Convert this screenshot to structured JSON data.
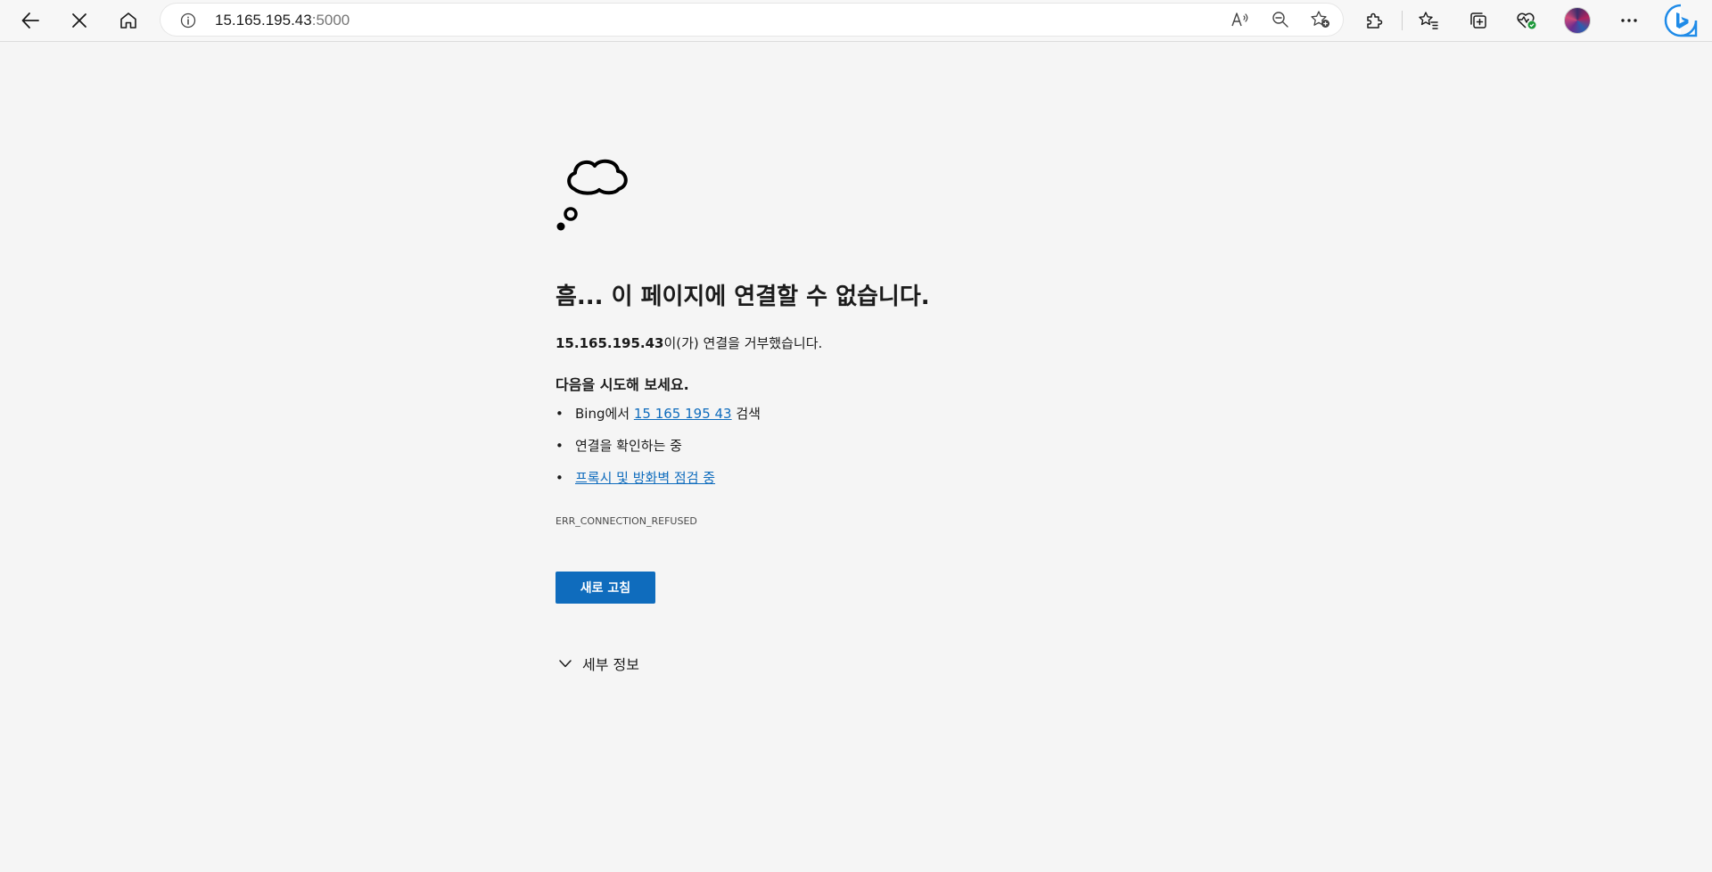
{
  "browser": {
    "url_host": "15.165.195.43",
    "url_port": ":5000",
    "icons": {
      "back": "back-arrow-icon",
      "stop": "close-icon",
      "home": "home-icon",
      "site_info": "info-icon",
      "read_aloud": "read-aloud-icon",
      "zoom": "zoom-out-icon",
      "add_favorite": "add-favorite-icon",
      "extensions": "puzzle-icon",
      "favorites": "favorites-icon",
      "collections": "collections-icon",
      "performance": "heart-pulse-icon",
      "profile": "avatar",
      "more": "more-icon",
      "copilot": "bing-icon"
    }
  },
  "error_page": {
    "title": "흠... 이 페이지에 연결할 수 없습니다.",
    "host": "15.165.195.43",
    "refused_text": "이(가) 연결을 거부했습니다.",
    "try_heading": "다음을 시도해 보세요.",
    "suggestions": {
      "bing_prefix": "Bing에서 ",
      "bing_link": "15 165 195 43",
      "bing_suffix": " 검색",
      "check_connection": "연결을 확인하는 중",
      "proxy_link": "프록시 및 방화벽 점검 중"
    },
    "error_code": "ERR_CONNECTION_REFUSED",
    "reload_label": "새로 고침",
    "details_label": "세부 정보"
  },
  "colors": {
    "accent": "#0f6cbd",
    "page_bg": "#f5f5f5"
  }
}
